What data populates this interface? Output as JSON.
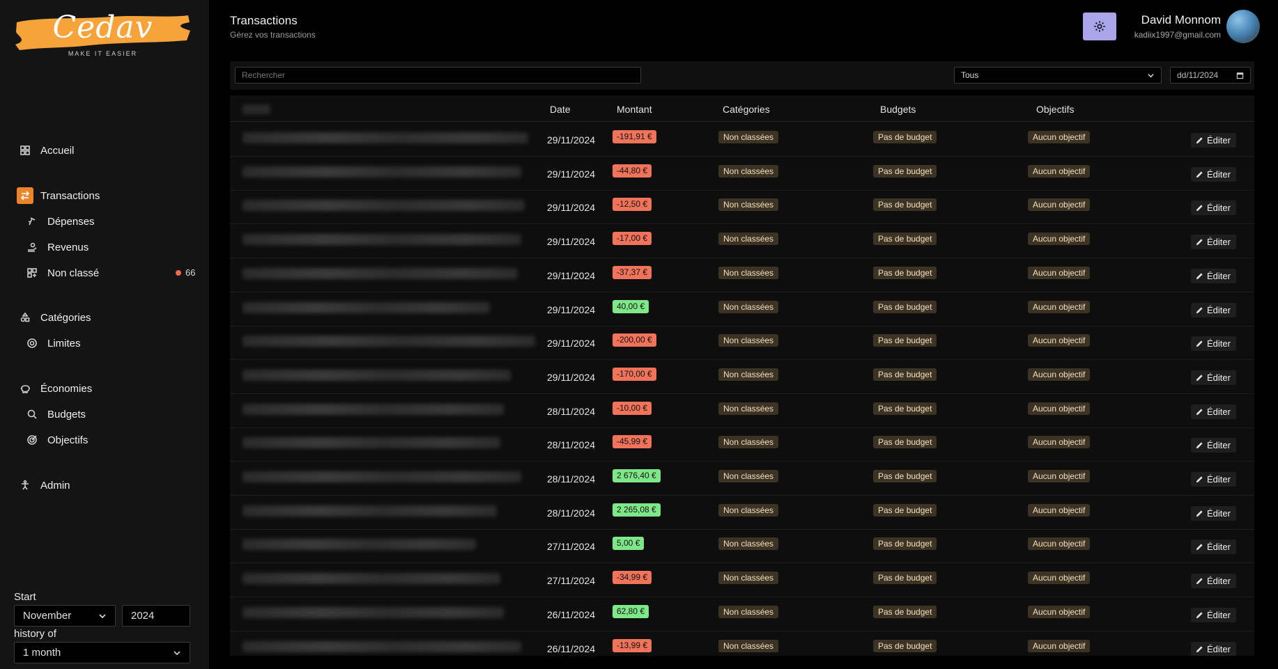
{
  "brand": {
    "name": "Cedav",
    "tagline": "MAKE IT EASIER",
    "accent": "#f5a33a"
  },
  "header": {
    "title": "Transactions",
    "subtitle": "Gérez vos transactions"
  },
  "user": {
    "name": "David Monnom",
    "email": "kadiix1997@gmail.com"
  },
  "settings_icon": "gear-icon",
  "nav": {
    "home": "Accueil",
    "transactions": "Transactions",
    "expenses": "Dépenses",
    "income": "Revenus",
    "unclassified": "Non classé",
    "unclassified_count": "66",
    "categories": "Catégories",
    "limits": "Limites",
    "savings": "Économies",
    "budgets": "Budgets",
    "goals": "Objectifs",
    "admin": "Admin"
  },
  "period": {
    "start_label": "Start",
    "month": "November",
    "year": "2024",
    "history_label": "history of",
    "history": "1 month"
  },
  "filters": {
    "search_placeholder": "Rechercher",
    "type": "Tous",
    "date": "dd/11/2024"
  },
  "table": {
    "columns": {
      "date": "Date",
      "amount": "Montant",
      "categories": "Catégories",
      "budgets": "Budgets",
      "goals": "Objectifs"
    },
    "edit_label": "Éditer",
    "rows": [
      {
        "date": "29/11/2024",
        "amount": "-191,91 €",
        "sign": "neg",
        "category": "Non classées",
        "budget": "Pas de budget",
        "goal": "Aucun objectif"
      },
      {
        "date": "29/11/2024",
        "amount": "-44,80 €",
        "sign": "neg",
        "category": "Non classées",
        "budget": "Pas de budget",
        "goal": "Aucun objectif"
      },
      {
        "date": "29/11/2024",
        "amount": "-12,50 €",
        "sign": "neg",
        "category": "Non classées",
        "budget": "Pas de budget",
        "goal": "Aucun objectif"
      },
      {
        "date": "29/11/2024",
        "amount": "-17,00 €",
        "sign": "neg",
        "category": "Non classées",
        "budget": "Pas de budget",
        "goal": "Aucun objectif"
      },
      {
        "date": "29/11/2024",
        "amount": "-37,37 €",
        "sign": "neg",
        "category": "Non classées",
        "budget": "Pas de budget",
        "goal": "Aucun objectif"
      },
      {
        "date": "29/11/2024",
        "amount": "40,00 €",
        "sign": "pos",
        "category": "Non classées",
        "budget": "Pas de budget",
        "goal": "Aucun objectif"
      },
      {
        "date": "29/11/2024",
        "amount": "-200,00 €",
        "sign": "neg",
        "category": "Non classées",
        "budget": "Pas de budget",
        "goal": "Aucun objectif"
      },
      {
        "date": "29/11/2024",
        "amount": "-170,00 €",
        "sign": "neg",
        "category": "Non classées",
        "budget": "Pas de budget",
        "goal": "Aucun objectif"
      },
      {
        "date": "28/11/2024",
        "amount": "-10,00 €",
        "sign": "neg",
        "category": "Non classées",
        "budget": "Pas de budget",
        "goal": "Aucun objectif"
      },
      {
        "date": "28/11/2024",
        "amount": "-45,99 €",
        "sign": "neg",
        "category": "Non classées",
        "budget": "Pas de budget",
        "goal": "Aucun objectif"
      },
      {
        "date": "28/11/2024",
        "amount": "2 676,40 €",
        "sign": "pos",
        "category": "Non classées",
        "budget": "Pas de budget",
        "goal": "Aucun objectif"
      },
      {
        "date": "28/11/2024",
        "amount": "2 265,08 €",
        "sign": "pos",
        "category": "Non classées",
        "budget": "Pas de budget",
        "goal": "Aucun objectif"
      },
      {
        "date": "27/11/2024",
        "amount": "5,00 €",
        "sign": "pos",
        "category": "Non classées",
        "budget": "Pas de budget",
        "goal": "Aucun objectif"
      },
      {
        "date": "27/11/2024",
        "amount": "-34,99 €",
        "sign": "neg",
        "category": "Non classées",
        "budget": "Pas de budget",
        "goal": "Aucun objectif"
      },
      {
        "date": "26/11/2024",
        "amount": "62,80 €",
        "sign": "pos",
        "category": "Non classées",
        "budget": "Pas de budget",
        "goal": "Aucun objectif"
      },
      {
        "date": "26/11/2024",
        "amount": "-13,99 €",
        "sign": "neg",
        "category": "Non classées",
        "budget": "Pas de budget",
        "goal": "Aucun objectif"
      }
    ]
  },
  "colors": {
    "negative": "#f0735a",
    "positive": "#7ee787",
    "active_nav": "#e8852b",
    "settings_button": "#a9a5e8",
    "tag_bg": "#3d3324"
  }
}
